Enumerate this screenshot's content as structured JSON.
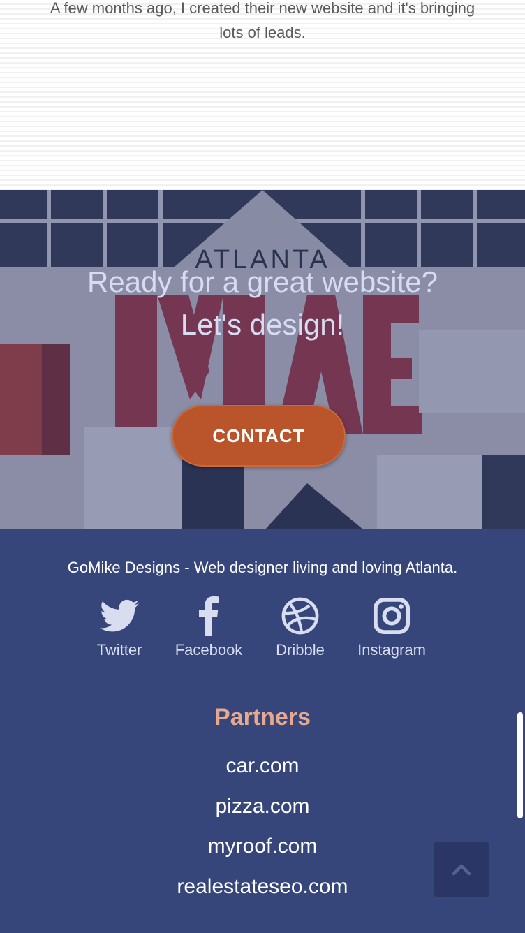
{
  "testimonial": {
    "text": "A few months ago, I created their new website and it's bringing lots of leads."
  },
  "hero": {
    "line1": "Ready for a great website?",
    "line2": "Let's design!",
    "mural_top": "ATLANTA",
    "mural_big": "MADE",
    "contact_label": "CONTACT",
    "colors": {
      "button": "#b9542b",
      "overlay": "#28346e"
    }
  },
  "footer": {
    "tagline": "GoMike Designs - Web designer living and loving Atlanta.",
    "social": [
      {
        "label": "Twitter",
        "icon": "twitter-icon"
      },
      {
        "label": "Facebook",
        "icon": "facebook-icon"
      },
      {
        "label": "Dribble",
        "icon": "dribbble-icon"
      },
      {
        "label": "Instagram",
        "icon": "instagram-icon"
      }
    ],
    "partners_title": "Partners",
    "partners": [
      "car.com",
      "pizza.com",
      "myroof.com",
      "realestateseo.com"
    ],
    "colors": {
      "background": "#36467a",
      "partners_title": "#e6a88e"
    }
  },
  "back_to_top": {
    "icon": "chevron-up-icon"
  }
}
